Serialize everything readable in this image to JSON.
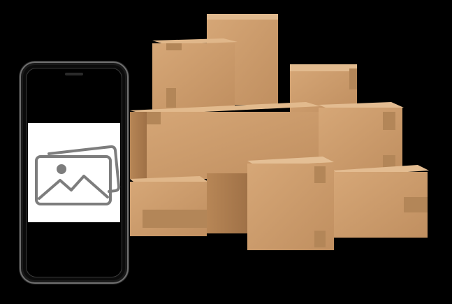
{
  "scene": {
    "background_color": "#000000",
    "box_color": "#c9986a",
    "tape_color": "#b38658"
  },
  "phone": {
    "frame_color": "#0b0b0b",
    "screen_color": "#000000",
    "image_placeholder_color": "#ffffff",
    "image_icon": "image-gallery-icon"
  }
}
